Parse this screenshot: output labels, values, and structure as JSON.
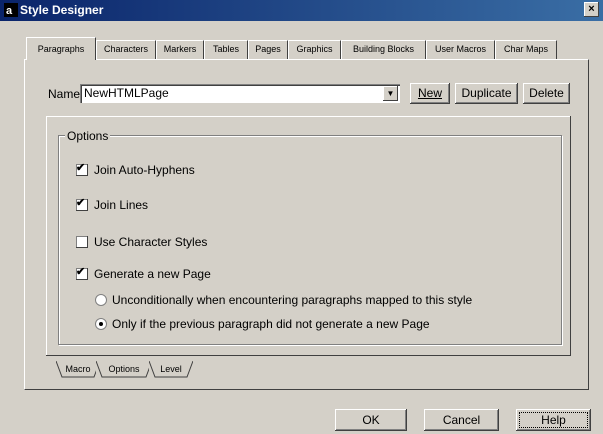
{
  "window": {
    "title": "Style Designer",
    "close": "×"
  },
  "tabs": [
    "Paragraphs",
    "Characters",
    "Markers",
    "Tables",
    "Pages",
    "Graphics",
    "Building Blocks",
    "User Macros",
    "Char Maps"
  ],
  "name": {
    "label": "Name",
    "value": "NewHTMLPage",
    "arrow": "▼"
  },
  "buttons": {
    "new": "New",
    "duplicate": "Duplicate",
    "delete": "Delete",
    "ok": "OK",
    "cancel": "Cancel",
    "help": "Help"
  },
  "options": {
    "group_label": "Options",
    "checkboxes": [
      {
        "label": "Join Auto-Hyphens",
        "checked": true
      },
      {
        "label": "Join Lines",
        "checked": true
      },
      {
        "label": "Use Character Styles",
        "checked": false
      },
      {
        "label": "Generate a new Page",
        "checked": true
      }
    ],
    "radios": [
      {
        "label": "Unconditionally when encountering paragraphs mapped to this style",
        "selected": false
      },
      {
        "label": "Only if the previous paragraph did not generate a new Page",
        "selected": true
      }
    ]
  },
  "bottom_tabs": [
    "Macro",
    "Options",
    "Level"
  ],
  "check_mark": "✔"
}
